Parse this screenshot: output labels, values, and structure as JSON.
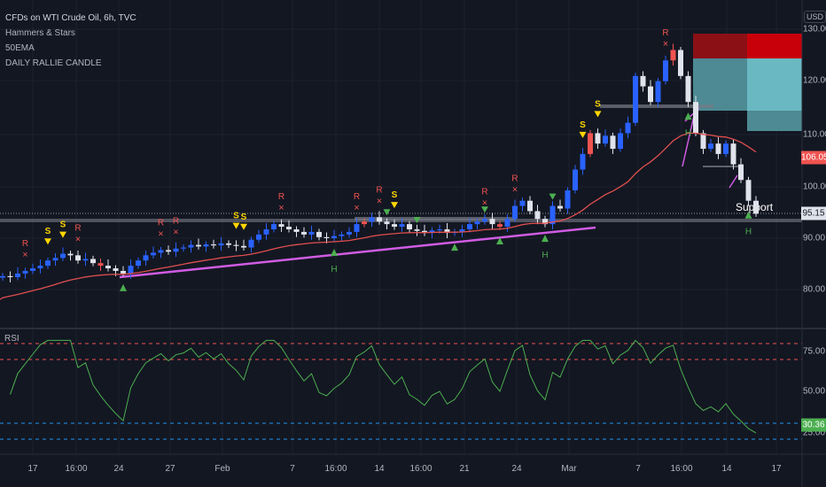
{
  "legend": {
    "title": "CFDs on WTI Crude Oil, 6h, TVC",
    "indicators": [
      "Hammers & Stars",
      "50EMA",
      "DAILY RALLIE CANDLE"
    ]
  },
  "price_axis": {
    "currency": "USD",
    "ticks": [
      "130.00",
      "120.00",
      "110.00",
      "100.00",
      "90.00",
      "80.00"
    ],
    "last_price": "106.05",
    "line_price": "95.15"
  },
  "rsi": {
    "label": "RSI",
    "ticks": [
      "75.00",
      "50.00",
      "25.00"
    ],
    "last_value": "30.36"
  },
  "annotations": {
    "support": "Support"
  },
  "marker_text": {
    "rally": "R",
    "star": "S",
    "hammer": "H"
  },
  "time_axis": [
    "17",
    "16:00",
    "24",
    "27",
    "Feb",
    "7",
    "16:00",
    "14",
    "16:00",
    "21",
    "24",
    "Mar",
    "7",
    "16:00",
    "14",
    "17"
  ],
  "colors": {
    "bg": "#131722",
    "up": "#2962ff",
    "down": "#e0e3eb",
    "rally": "#ef5350",
    "ema": "#e04f4f",
    "rsi": "#4caf50",
    "trend": "#d05ce3"
  },
  "chart_data": {
    "type": "candlestick",
    "title": "CFDs on WTI Crude Oil, 6h, TVC",
    "ylim": [
      75,
      132
    ],
    "closes": [
      82.5,
      82.3,
      83,
      83.5,
      84,
      84.5,
      85.5,
      86,
      86.8,
      86.5,
      85.5,
      85.8,
      85,
      84.5,
      84,
      83.5,
      83,
      84.5,
      85.5,
      86.5,
      87,
      87.5,
      87.2,
      87.8,
      88,
      88.5,
      88.2,
      88.6,
      88.4,
      88.8,
      88.5,
      88.3,
      88,
      89.5,
      90.5,
      91.5,
      92.5,
      92,
      91.5,
      91,
      90.5,
      91,
      90,
      89.8,
      90.2,
      90.5,
      91,
      92.5,
      93,
      93.8,
      93,
      92.5,
      92,
      92.5,
      91.5,
      91.2,
      90.8,
      91.3,
      91.5,
      90.8,
      91,
      91.5,
      92.5,
      93,
      93.5,
      92.5,
      92,
      93.5,
      96,
      97,
      95,
      93.5,
      92.5,
      96,
      95.5,
      99,
      103,
      106,
      110,
      108,
      109.5,
      107,
      110,
      112,
      121,
      119,
      116,
      120,
      124,
      126,
      121,
      116,
      110,
      107,
      108,
      106,
      108,
      104,
      101,
      97,
      94.5
    ],
    "rally_candles": [
      13,
      48,
      66,
      78,
      89
    ],
    "markers": {
      "R": [
        3,
        10,
        21,
        23,
        37,
        47,
        50,
        64,
        68,
        88
      ],
      "S": [
        6,
        8,
        31,
        32,
        52,
        77,
        79
      ],
      "hammer_up": [
        16,
        44,
        60,
        66,
        72,
        91,
        99
      ],
      "H": [
        44,
        72,
        91,
        99
      ],
      "green_down": [
        51,
        55,
        64,
        73
      ]
    },
    "ema_period": 25,
    "ema_seed": 78,
    "rsi_period": 8,
    "rsi_levels": [
      80,
      70,
      30,
      20
    ],
    "rsi_ylim": [
      15,
      85
    ]
  }
}
